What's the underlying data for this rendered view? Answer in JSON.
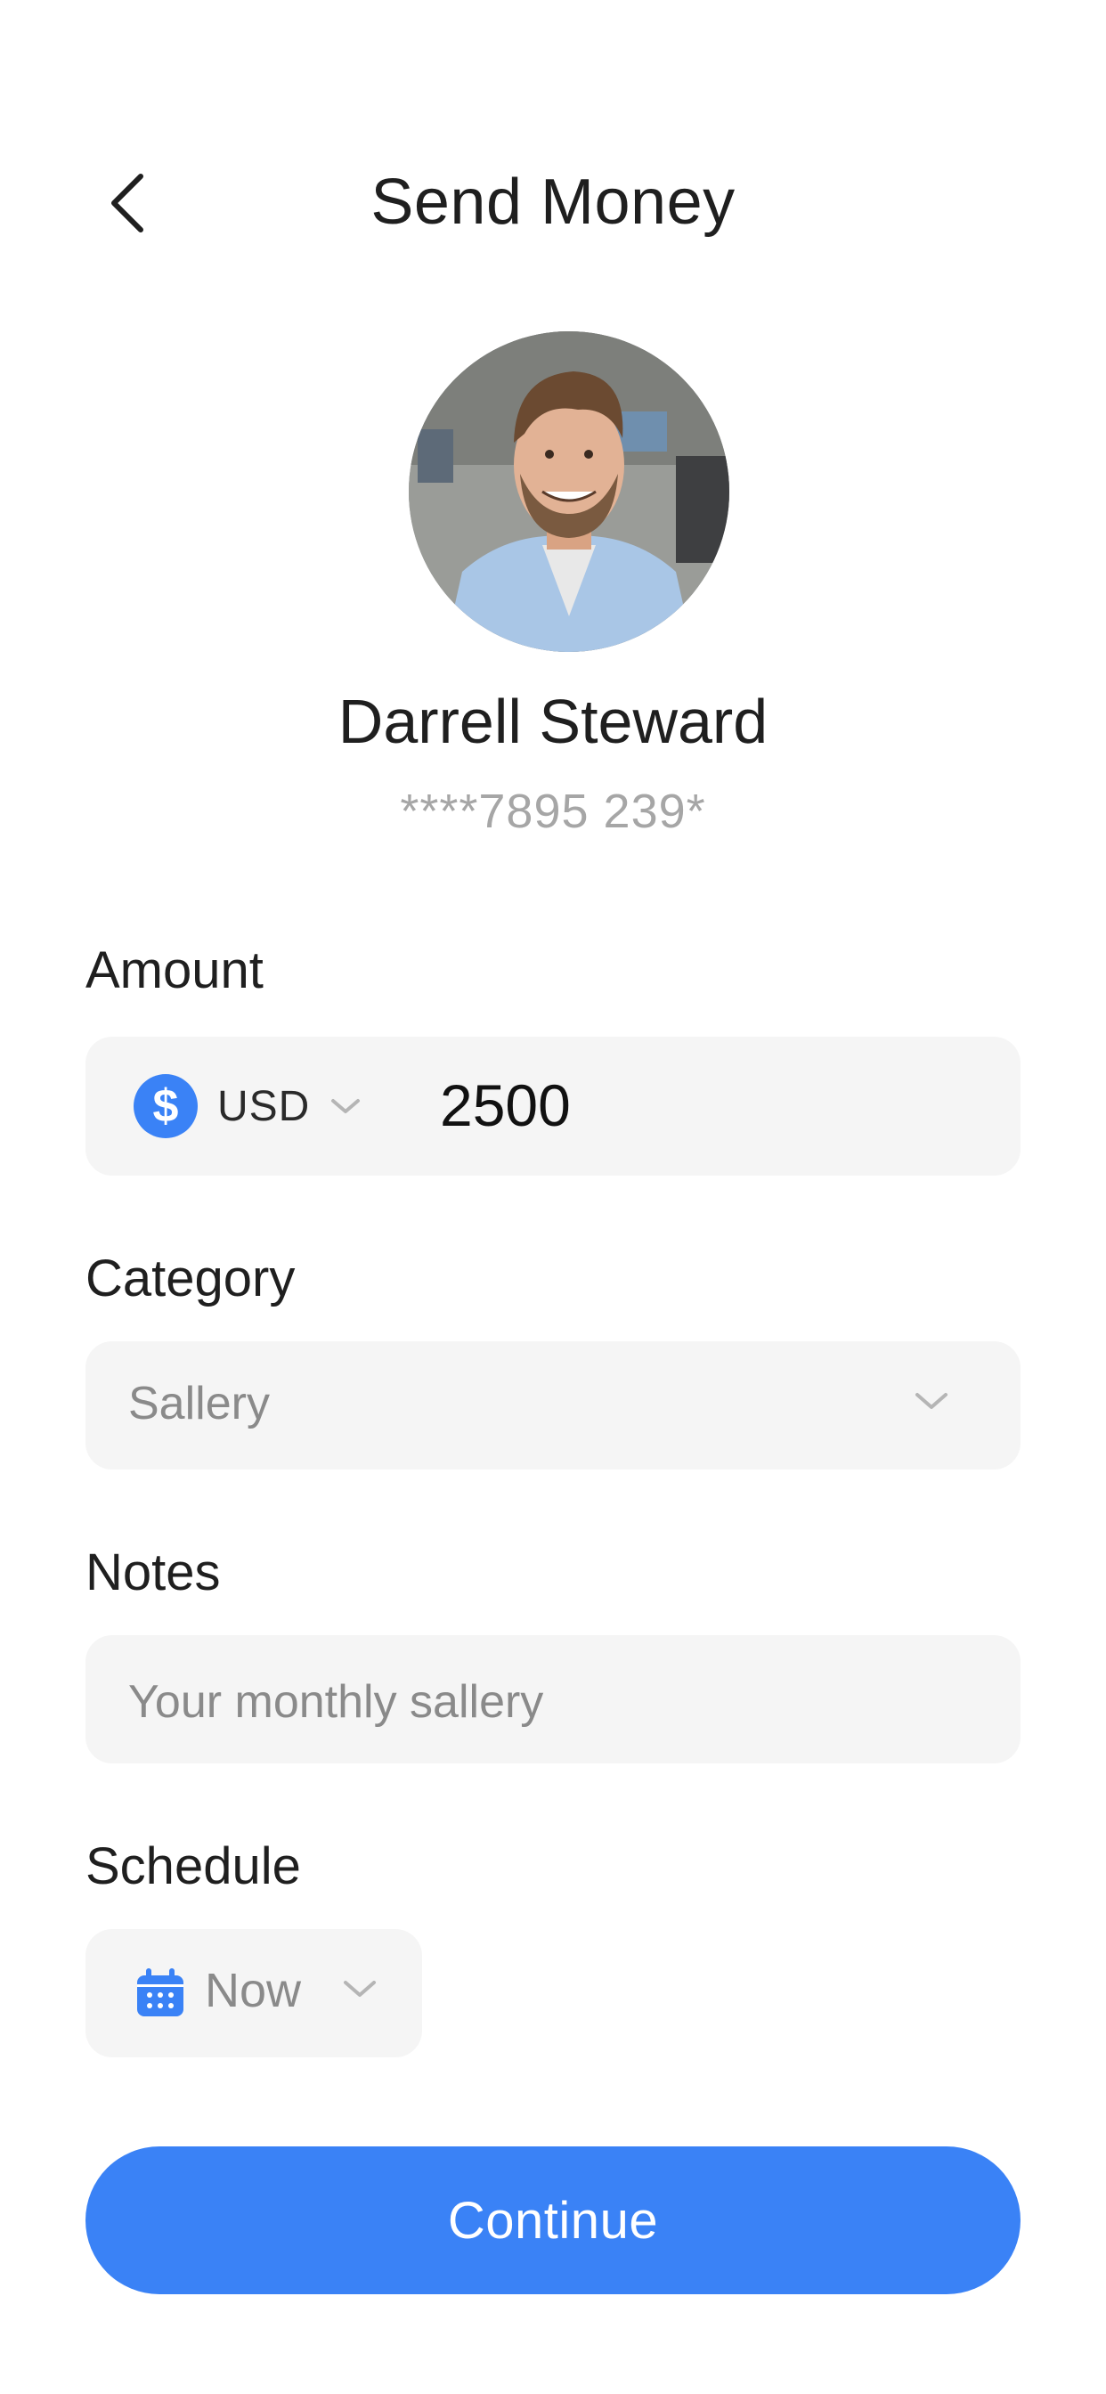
{
  "header": {
    "title": "Send Money",
    "back_icon": "chevron-left-icon"
  },
  "recipient": {
    "name": "Darrell Steward",
    "account": "****7895 239*"
  },
  "amount": {
    "label": "Amount",
    "currency": "USD",
    "currency_icon": "dollar-icon",
    "value": "2500"
  },
  "category": {
    "label": "Category",
    "value": "Sallery"
  },
  "notes": {
    "label": "Notes",
    "placeholder": "Your monthly sallery"
  },
  "schedule": {
    "label": "Schedule",
    "value": "Now",
    "icon": "calendar-icon"
  },
  "actions": {
    "continue_label": "Continue"
  },
  "colors": {
    "accent": "#3a82f6",
    "field_bg": "#f5f5f5",
    "muted_text": "#8a8a8a"
  }
}
